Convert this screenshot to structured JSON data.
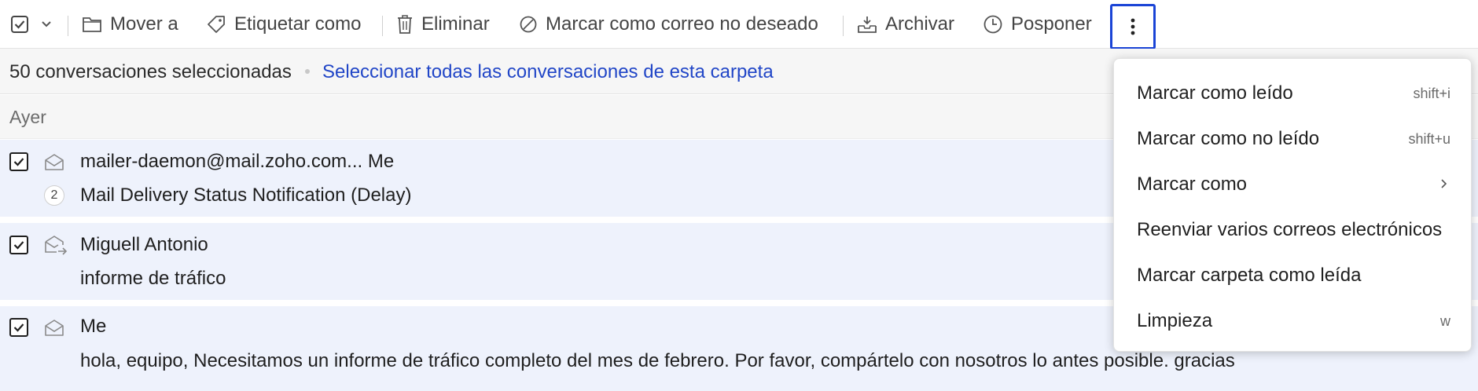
{
  "toolbar": {
    "select_checkbox_icon": "checkbox-checked-icon",
    "select_dropdown_icon": "chevron-down-icon",
    "move_label": "Mover a",
    "tag_label": "Etiquetar como",
    "delete_label": "Eliminar",
    "spam_label": "Marcar como correo no deseado",
    "archive_label": "Archivar",
    "snooze_label": "Posponer",
    "more_icon": "more-vertical-icon"
  },
  "selection": {
    "count_text": "50 conversaciones seleccionadas",
    "select_all_link": "Seleccionar todas las conversaciones de esta carpeta"
  },
  "group_header": "Ayer",
  "messages": [
    {
      "sender": "mailer-daemon@mail.zoho.com... Me",
      "subject": "Mail Delivery Status Notification (Delay)",
      "thread_count": "2",
      "checked": true,
      "icon": "envelope-open-icon"
    },
    {
      "sender": "Miguell Antonio",
      "subject": "informe de tráfico",
      "checked": true,
      "icon": "envelope-forward-icon"
    },
    {
      "sender": "Me",
      "subject": "hola, equipo, Necesitamos un informe de tráfico completo del mes de febrero. Por favor, compártelo con nosotros lo antes posible. gracias",
      "checked": true,
      "icon": "envelope-open-icon"
    }
  ],
  "menu": {
    "items": [
      {
        "label": "Marcar como leído",
        "shortcut": "shift+i"
      },
      {
        "label": "Marcar como no leído",
        "shortcut": "shift+u"
      },
      {
        "label": "Marcar como",
        "submenu": true
      },
      {
        "label": "Reenviar varios correos electrónicos"
      },
      {
        "label": "Marcar carpeta como leída"
      },
      {
        "label": "Limpieza",
        "shortcut": "w"
      }
    ]
  },
  "colors": {
    "accent": "#1a44d6",
    "link": "#2146c7",
    "row_selected_bg": "#eef2fc"
  }
}
